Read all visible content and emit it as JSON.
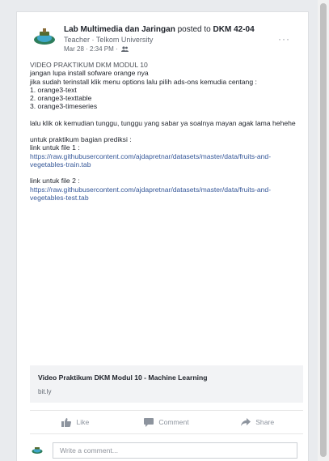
{
  "post": {
    "author": "Lab Multimedia dan Jaringan",
    "posted_to_text": " posted to ",
    "group": "DKM 42-04",
    "role": "Teacher · Telkom University",
    "timestamp": "Mar 28 · 2:34 PM ·",
    "audience_icon": "group-icon",
    "more_label": "···",
    "lines": {
      "title": "VIDEO PRAKTIKUM DKM MODUL 10",
      "l1": "jangan lupa install sofware orange nya",
      "l2": "jika sudah terinstall klik menu options lalu pilih ads-ons kemudia centang :",
      "l3": "1. orange3-text",
      "l4": "2. orange3-texttable",
      "l5": "3. orange3-timeseries",
      "l6": "lalu klik ok kemudian tunggu, tunggu yang sabar ya soalnya mayan agak lama hehehe",
      "l7": "untuk praktikum bagian prediksi :",
      "l8": "link untuk file 1 :",
      "link1": "https://raw.githubusercontent.com/ajdapretnar/datasets/master/data/fruits-and-vegetables-train.tab",
      "l9": "link untuk file 2 :",
      "link2": "https://raw.githubusercontent.com/ajdapretnar/datasets/master/data/fruits-and-vegetables-test.tab"
    },
    "link_preview": {
      "title": "Video Praktikum DKM Modul 10 - Machine Learning",
      "domain": "bit.ly"
    },
    "actions": {
      "like": "Like",
      "comment": "Comment",
      "share": "Share"
    },
    "comment_placeholder": "Write a comment..."
  },
  "colors": {
    "link": "#365899",
    "muted": "#90949c",
    "background": "#e9ebee"
  }
}
